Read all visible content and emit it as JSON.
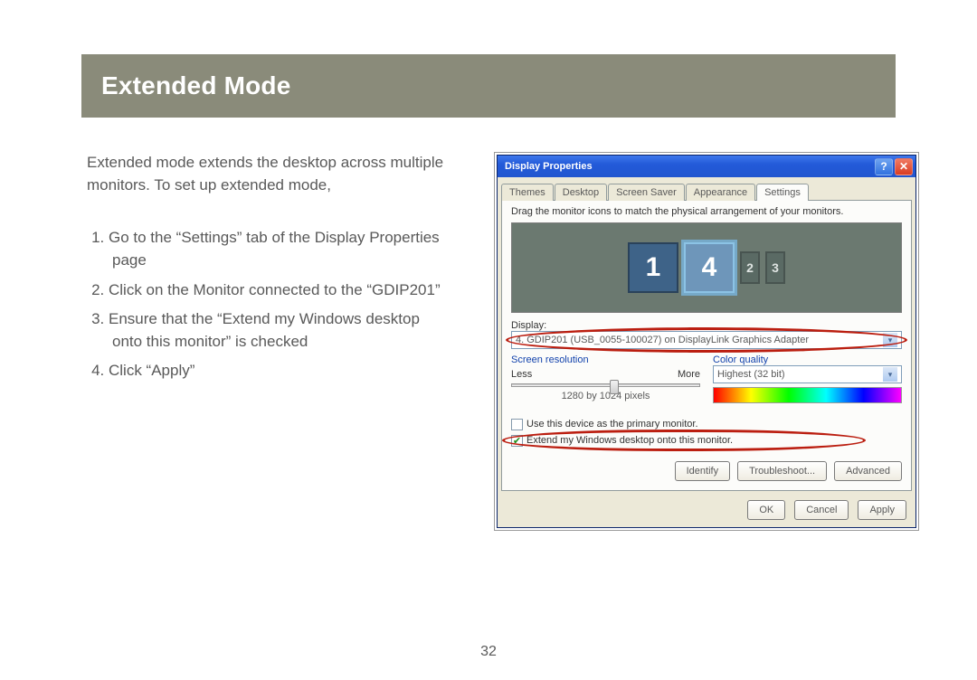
{
  "page_number": "32",
  "banner": {
    "title": "Extended Mode"
  },
  "intro": "Extended mode extends the desktop across multiple monitors. To set up extended mode,",
  "steps": [
    "Go to the “Settings” tab of the Display Properties page",
    "Click on the Monitor connected to the “GDIP201”",
    "Ensure that the “Extend my Windows desktop onto this monitor” is checked",
    "Click “Apply”"
  ],
  "dialog": {
    "title": "Display Properties",
    "tabs": [
      "Themes",
      "Desktop",
      "Screen Saver",
      "Appearance",
      "Settings"
    ],
    "active_tab": 4,
    "hint": "Drag the monitor icons to match the physical arrangement of your monitors.",
    "monitors": [
      "1",
      "4",
      "2",
      "3"
    ],
    "display_label": "Display:",
    "display_value": "4. GDIP201 (USB_0055-100027) on DisplayLink Graphics Adapter",
    "screen_res_label": "Screen resolution",
    "less": "Less",
    "more": "More",
    "res_value": "1280 by 1024 pixels",
    "color_label": "Color quality",
    "color_value": "Highest (32 bit)",
    "check_primary": "Use this device as the primary monitor.",
    "check_extend": "Extend my Windows desktop onto this monitor.",
    "btn_identify": "Identify",
    "btn_troubleshoot": "Troubleshoot...",
    "btn_advanced": "Advanced",
    "btn_ok": "OK",
    "btn_cancel": "Cancel",
    "btn_apply": "Apply"
  }
}
